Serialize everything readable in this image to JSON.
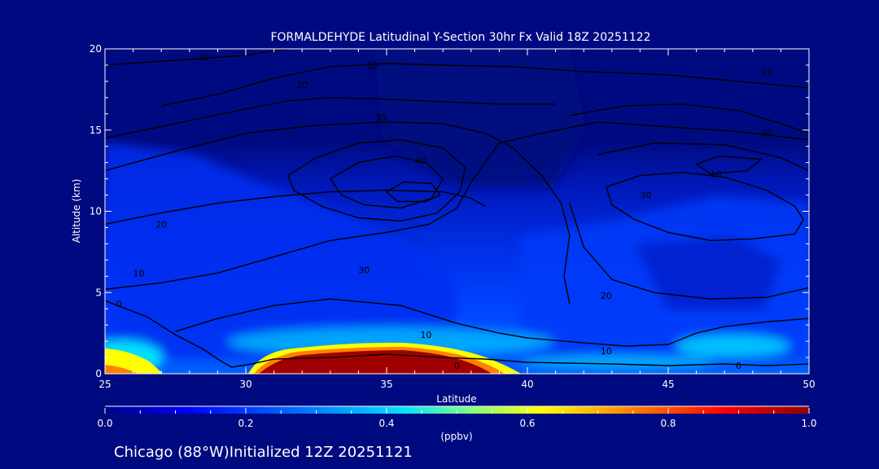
{
  "chart_data": {
    "type": "heatmap",
    "title": "FORMALDEHYDE Latitudinal Y-Section 30hr  Fx Valid 18Z 20251122",
    "xlabel": "Latitude",
    "ylabel": "Altitude (km)",
    "xlim": [
      25,
      50
    ],
    "ylim": [
      0,
      20
    ],
    "x_ticks": [
      25,
      30,
      35,
      40,
      45,
      50
    ],
    "y_ticks": [
      0,
      5,
      10,
      15,
      20
    ],
    "colorbar": {
      "label": "(ppbv)",
      "range": [
        0.0,
        1.0
      ],
      "ticks": [
        "0.0",
        "0.2",
        "0.4",
        "0.6",
        "0.8",
        "1.0"
      ],
      "colors": [
        "#00008c",
        "#0000ff",
        "#0080ff",
        "#00e0ff",
        "#80ff80",
        "#ffff00",
        "#ff8000",
        "#ff0000",
        "#8c0000"
      ]
    },
    "contours": [
      {
        "label": "10",
        "points": [
          [
            25,
            5.2
          ],
          [
            27,
            5.6
          ],
          [
            29,
            6.2
          ],
          [
            31,
            7.2
          ],
          [
            33,
            8.2
          ],
          [
            35,
            8.7
          ],
          [
            36.5,
            9.2
          ],
          [
            37.5,
            10.2
          ],
          [
            38,
            11.8
          ],
          [
            38.5,
            13
          ],
          [
            39,
            14.2
          ],
          [
            40.5,
            14.8
          ],
          [
            42.5,
            15.5
          ],
          [
            45,
            15.2
          ],
          [
            47.5,
            14.9
          ],
          [
            50,
            14.4
          ]
        ]
      },
      {
        "label": "20",
        "points": [
          [
            25,
            9.2
          ],
          [
            27,
            9.9
          ],
          [
            29,
            10.5
          ],
          [
            31,
            10.9
          ],
          [
            33,
            11.2
          ],
          [
            35,
            11.3
          ],
          [
            37,
            11.2
          ],
          [
            38,
            10.8
          ],
          [
            38.5,
            10.3
          ]
        ]
      },
      {
        "label": "30",
        "points": [
          [
            25,
            12.5
          ],
          [
            27.5,
            13.7
          ],
          [
            30,
            14.8
          ],
          [
            32.5,
            15.3
          ],
          [
            35,
            15.5
          ],
          [
            37,
            15.4
          ],
          [
            38.5,
            14.8
          ],
          [
            39.5,
            13.9
          ],
          [
            40.5,
            12.2
          ],
          [
            41.2,
            10.5
          ],
          [
            41.5,
            8.5
          ],
          [
            41.3,
            6
          ],
          [
            41.5,
            4.3
          ]
        ]
      },
      {
        "label": "40",
        "points": [
          [
            31.5,
            12.2
          ],
          [
            32.5,
            13.3
          ],
          [
            34,
            14.2
          ],
          [
            35.5,
            14.4
          ],
          [
            37,
            13.9
          ],
          [
            37.8,
            12.7
          ],
          [
            37.6,
            11.2
          ],
          [
            36.8,
            9.9
          ],
          [
            35.5,
            9.4
          ],
          [
            34,
            9.6
          ],
          [
            32.7,
            10.3
          ],
          [
            31.7,
            11.3
          ],
          [
            31.5,
            12.2
          ]
        ]
      },
      {
        "label": "40",
        "points": [
          [
            33,
            12
          ],
          [
            34,
            13
          ],
          [
            35.3,
            13.4
          ],
          [
            36.4,
            13
          ],
          [
            37,
            12
          ],
          [
            36.6,
            10.8
          ],
          [
            35.5,
            10.2
          ],
          [
            34.2,
            10.4
          ],
          [
            33.4,
            11
          ],
          [
            33,
            12
          ]
        ]
      },
      {
        "label": "",
        "points": [
          [
            35,
            11.2
          ],
          [
            35.6,
            11.8
          ],
          [
            36.6,
            11.7
          ],
          [
            36.9,
            11
          ],
          [
            36.4,
            10.6
          ],
          [
            35.4,
            10.6
          ],
          [
            35,
            11.2
          ]
        ]
      },
      {
        "label": "30",
        "points": [
          [
            42.8,
            11.5
          ],
          [
            44,
            12.2
          ],
          [
            45.5,
            12.4
          ],
          [
            47,
            12.1
          ],
          [
            48.5,
            11.3
          ],
          [
            49.5,
            10.3
          ],
          [
            49.8,
            9.5
          ],
          [
            49.5,
            8.6
          ],
          [
            48,
            8.3
          ],
          [
            46.5,
            8.2
          ],
          [
            45,
            8.7
          ],
          [
            43.8,
            9.5
          ],
          [
            43,
            10.4
          ],
          [
            42.8,
            11.5
          ]
        ]
      },
      {
        "label": "10",
        "points": [
          [
            46,
            12.9
          ],
          [
            46.8,
            13.4
          ],
          [
            48.3,
            13.2
          ],
          [
            47.8,
            12.5
          ],
          [
            46.5,
            12.3
          ],
          [
            46,
            12.9
          ]
        ]
      },
      {
        "label": "20",
        "points": [
          [
            42.5,
            13.5
          ],
          [
            44.5,
            14.2
          ],
          [
            47,
            14.1
          ],
          [
            49,
            13.3
          ],
          [
            50,
            12.5
          ]
        ]
      },
      {
        "label": "20",
        "points": [
          [
            41.5,
            10.5
          ],
          [
            42,
            7.8
          ],
          [
            43,
            5.8
          ],
          [
            44.5,
            5
          ],
          [
            46.5,
            4.6
          ],
          [
            48.5,
            4.7
          ],
          [
            50,
            5.3
          ]
        ]
      },
      {
        "label": "10",
        "points": [
          [
            27.5,
            2.6
          ],
          [
            29,
            3.4
          ],
          [
            31,
            4.2
          ],
          [
            33,
            4.6
          ],
          [
            35.5,
            4.2
          ],
          [
            37.5,
            3.1
          ],
          [
            39,
            2.5
          ],
          [
            40,
            2.2
          ],
          [
            42,
            1.9
          ],
          [
            43.5,
            1.7
          ],
          [
            45,
            1.8
          ],
          [
            46,
            2.5
          ],
          [
            47,
            2.9
          ],
          [
            48.5,
            3.2
          ],
          [
            50,
            3.4
          ]
        ]
      },
      {
        "label": "0",
        "points": [
          [
            25,
            4.5
          ],
          [
            26.5,
            3.5
          ],
          [
            27.5,
            2.4
          ],
          [
            28.5,
            1.5
          ],
          [
            29,
            0.9
          ],
          [
            29.5,
            0.4
          ],
          [
            30.2,
            0.6
          ],
          [
            31,
            0.9
          ],
          [
            33,
            1.0
          ],
          [
            35,
            1.2
          ],
          [
            37,
            1.0
          ],
          [
            38.5,
            0.9
          ],
          [
            40,
            0.7
          ],
          [
            43,
            0.6
          ],
          [
            45,
            0.5
          ],
          [
            47,
            0.6
          ],
          [
            48.5,
            0.5
          ],
          [
            50,
            0.6
          ]
        ]
      },
      {
        "label": "30",
        "points": [
          [
            25,
            19.0
          ],
          [
            27.5,
            19.3
          ],
          [
            30,
            19.6
          ],
          [
            31.5,
            20
          ]
        ]
      },
      {
        "label": "10",
        "points": [
          [
            27,
            16.5
          ],
          [
            29,
            17.2
          ],
          [
            31,
            18.2
          ],
          [
            33,
            18.9
          ],
          [
            35,
            19.1
          ],
          [
            37,
            19.0
          ],
          [
            39.5,
            18.9
          ],
          [
            42,
            18.6
          ],
          [
            45,
            18.4
          ],
          [
            47.5,
            18.0
          ],
          [
            50,
            17.6
          ]
        ]
      },
      {
        "label": "20",
        "points": [
          [
            25,
            14.5
          ],
          [
            27.5,
            15.4
          ],
          [
            30,
            16.3
          ],
          [
            31.5,
            16.8
          ],
          [
            33,
            17
          ],
          [
            35,
            16.9
          ],
          [
            37.5,
            16.7
          ],
          [
            39,
            16.6
          ],
          [
            41,
            16.6
          ]
        ]
      },
      {
        "label": "20",
        "points": [
          [
            41.5,
            15.9
          ],
          [
            43.5,
            16.5
          ],
          [
            45.5,
            16.6
          ],
          [
            47.5,
            16.2
          ],
          [
            49,
            15.4
          ],
          [
            50,
            14.8
          ]
        ]
      }
    ],
    "contour_labels": [
      {
        "text": "30",
        "x": 28.5,
        "y": 19.5
      },
      {
        "text": "10",
        "x": 34.5,
        "y": 19.0
      },
      {
        "text": "20",
        "x": 32,
        "y": 17.8
      },
      {
        "text": "30",
        "x": 34.8,
        "y": 15.8
      },
      {
        "text": "40",
        "x": 36.2,
        "y": 13.1
      },
      {
        "text": "10",
        "x": 48.5,
        "y": 18.6
      },
      {
        "text": "20",
        "x": 48.5,
        "y": 14.8
      },
      {
        "text": "10",
        "x": 46.7,
        "y": 12.3
      },
      {
        "text": "30",
        "x": 44.2,
        "y": 11.0
      },
      {
        "text": "20",
        "x": 27.0,
        "y": 9.2
      },
      {
        "text": "30",
        "x": 34.2,
        "y": 6.4
      },
      {
        "text": "10",
        "x": 26.2,
        "y": 6.2
      },
      {
        "text": "0",
        "x": 25.5,
        "y": 4.3
      },
      {
        "text": "20",
        "x": 42.8,
        "y": 4.8
      },
      {
        "text": "10",
        "x": 36.4,
        "y": 2.4
      },
      {
        "text": "10",
        "x": 42.8,
        "y": 1.4
      },
      {
        "text": "0",
        "x": 37.5,
        "y": 0.5
      },
      {
        "text": "0",
        "x": 47.5,
        "y": 0.5
      }
    ]
  },
  "footer": {
    "location_text": "Chicago (88°W)Initialized 12Z 20251121"
  }
}
